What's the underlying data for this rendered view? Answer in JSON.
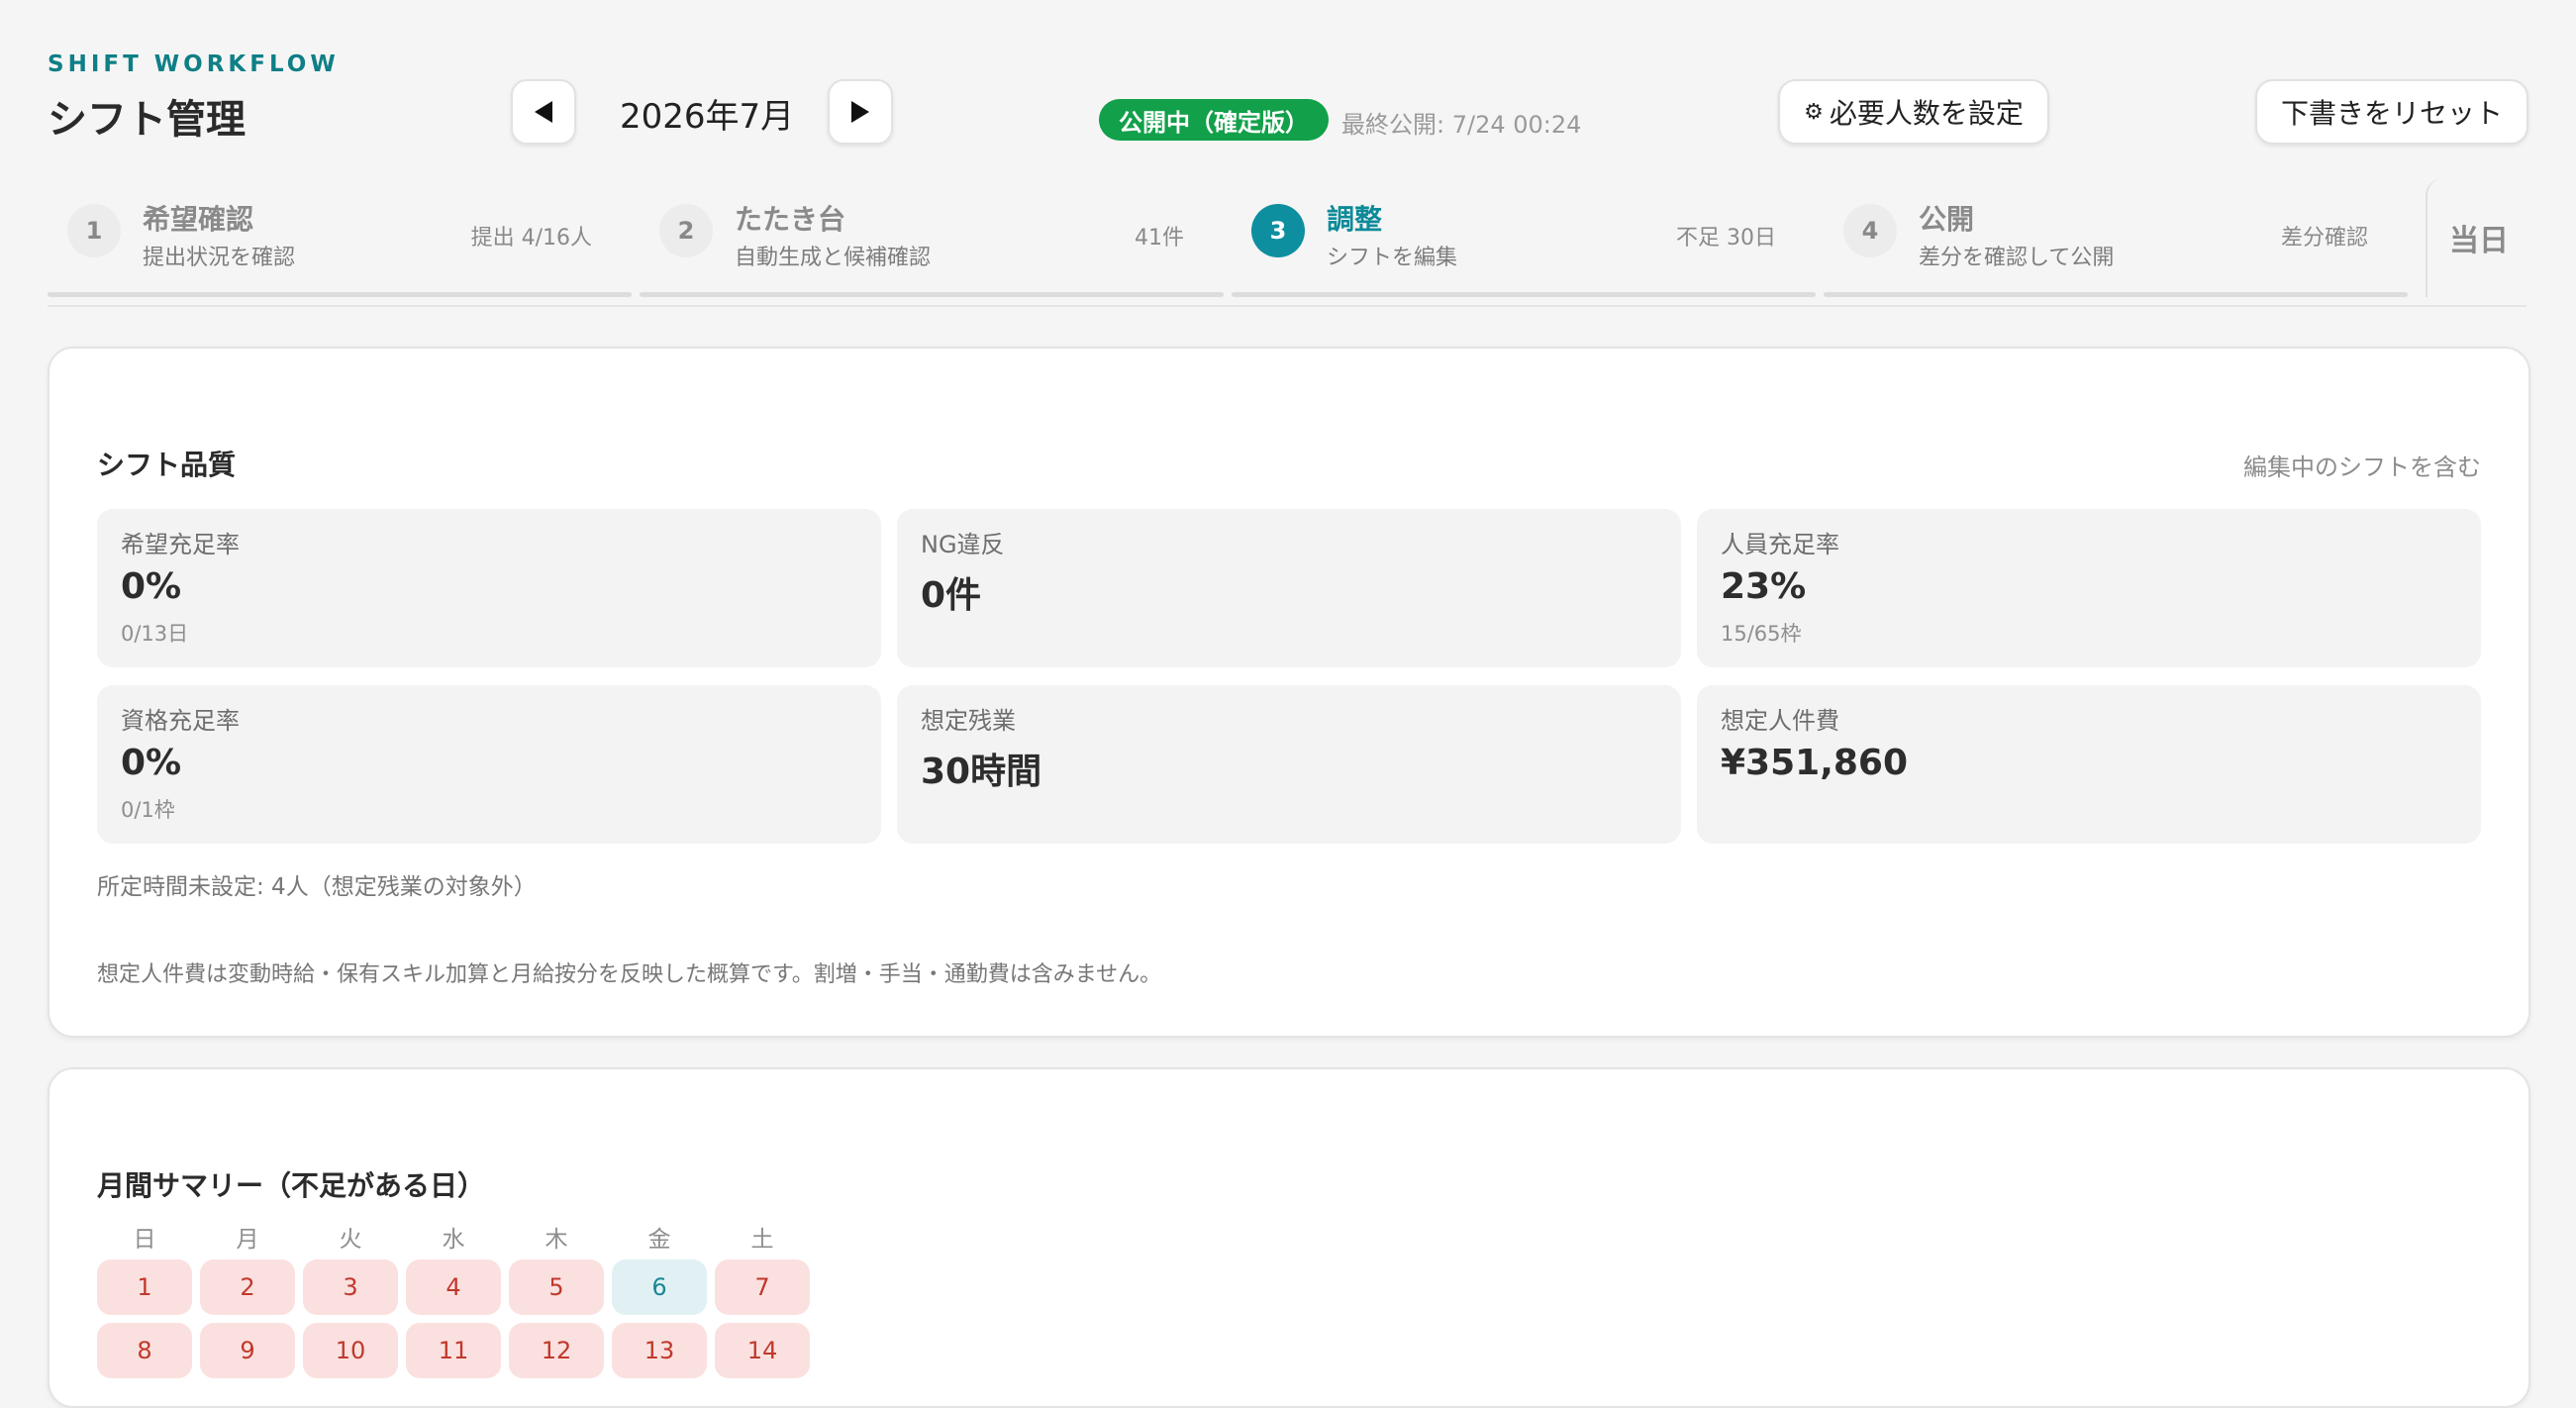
{
  "header": {
    "eyebrow": "SHIFT WORKFLOW",
    "title": "シフト管理",
    "month": "2026年7月",
    "prev_icon": "triangle-left-icon",
    "next_icon": "triangle-right-icon",
    "status": "公開中（確定版）",
    "status_color": "#12a04a",
    "last_published": "最終公開: 7/24 00:24",
    "required_btn_icon": "gear-icon",
    "required_btn": "必要人数を設定",
    "reset_btn": "下書きをリセット"
  },
  "steps": [
    {
      "num": "1",
      "name": "希望確認",
      "sub": "提出状況を確認",
      "meta": "提出 4/16人",
      "active": false
    },
    {
      "num": "2",
      "name": "たたき台",
      "sub": "自動生成と候補確認",
      "meta": "41件",
      "active": false
    },
    {
      "num": "3",
      "name": "調整",
      "sub": "シフトを編集",
      "meta": "不足 30日",
      "active": true
    },
    {
      "num": "4",
      "name": "公開",
      "sub": "差分を確認して公開",
      "meta": "差分確認",
      "active": false
    }
  ],
  "today_tab": "当日",
  "quality": {
    "title": "シフト品質",
    "note": "編集中のシフトを含む",
    "metrics": [
      {
        "label": "希望充足率",
        "value": "0%",
        "sub": "0/13日"
      },
      {
        "label": "NG違反",
        "value": "0件",
        "sub": ""
      },
      {
        "label": "人員充足率",
        "value": "23%",
        "sub": "15/65枠"
      },
      {
        "label": "資格充足率",
        "value": "0%",
        "sub": "0/1枠"
      },
      {
        "label": "想定残業",
        "value": "30時間",
        "sub": ""
      },
      {
        "label": "想定人件費",
        "value": "¥351,860",
        "sub": ""
      }
    ],
    "footnote1": "所定時間未設定: 4人（想定残業の対象外）",
    "footnote2": "想定人件費は変動時給・保有スキル加算と月給按分を反映した概算です。割増・手当・通勤費は含みません。"
  },
  "summary": {
    "title": "月間サマリー（不足がある日）",
    "weekdays": [
      "日",
      "月",
      "火",
      "水",
      "木",
      "金",
      "土"
    ],
    "days": [
      {
        "d": "1",
        "status": "short"
      },
      {
        "d": "2",
        "status": "short"
      },
      {
        "d": "3",
        "status": "short"
      },
      {
        "d": "4",
        "status": "short"
      },
      {
        "d": "5",
        "status": "short"
      },
      {
        "d": "6",
        "status": "ok"
      },
      {
        "d": "7",
        "status": "short"
      },
      {
        "d": "8",
        "status": "short"
      },
      {
        "d": "9",
        "status": "short"
      },
      {
        "d": "10",
        "status": "short"
      },
      {
        "d": "11",
        "status": "short"
      },
      {
        "d": "12",
        "status": "short"
      },
      {
        "d": "13",
        "status": "short"
      },
      {
        "d": "14",
        "status": "short"
      }
    ]
  }
}
